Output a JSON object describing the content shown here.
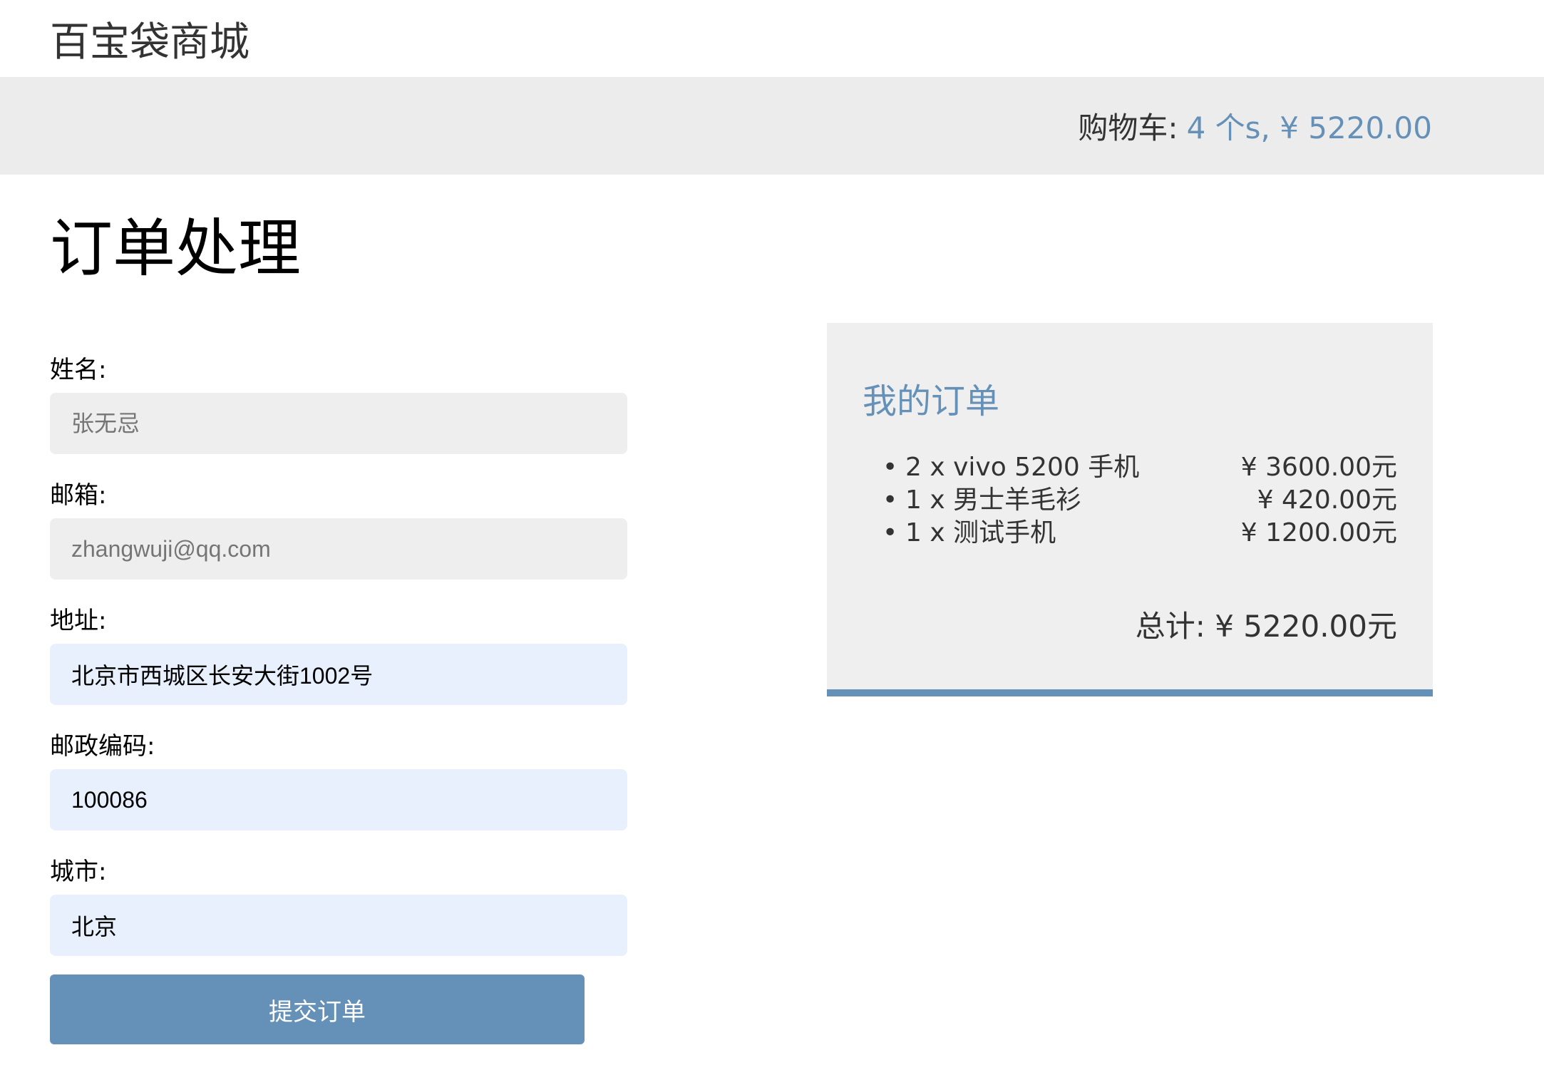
{
  "header": {
    "logo": "百宝袋商城"
  },
  "cart": {
    "label": "购物车:",
    "summary": "4 个s, ¥ 5220.00"
  },
  "page": {
    "title": "订单处理"
  },
  "form": {
    "name": {
      "label": "姓名:",
      "placeholder": "张无忌",
      "value": ""
    },
    "email": {
      "label": "邮箱:",
      "placeholder": "zhangwuji@qq.com",
      "value": ""
    },
    "address": {
      "label": "地址:",
      "value": "北京市西城区长安大街1002号"
    },
    "postal_code": {
      "label": "邮政编码:",
      "value": "100086"
    },
    "city": {
      "label": "城市:",
      "value": "北京"
    },
    "submit_label": "提交订单"
  },
  "order": {
    "title": "我的订单",
    "items": [
      {
        "description": "2 x vivo 5200 手机",
        "price": "¥ 3600.00元"
      },
      {
        "description": "1 x 男士羊毛衫",
        "price": "¥ 420.00元"
      },
      {
        "description": "1 x 测试手机",
        "price": "¥ 1200.00元"
      }
    ],
    "total": "总计: ¥ 5220.00元"
  },
  "colors": {
    "accent": "#6591b8",
    "bar_background": "#ececec",
    "summary_background": "#efefef",
    "autofill_background": "#e8f0fe"
  }
}
